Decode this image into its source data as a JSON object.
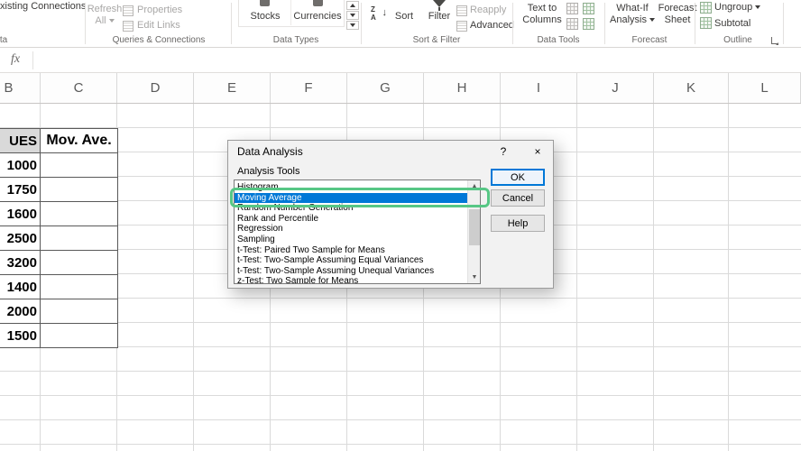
{
  "colors": {
    "selection_blue": "#0078d7",
    "annotation_green": "#57c785",
    "table_header_fill": "#d9d9d9",
    "grid_line": "#dadada"
  },
  "icons": {
    "letter_z": "Z",
    "letter_a": "A",
    "arrow_down": "↓",
    "help": "?",
    "close": "×",
    "scroll_up": "▲",
    "scroll_down": "▼"
  },
  "ribbon": {
    "clipped_button_label": "xisting Connections",
    "clipped_group_label": "ta",
    "refresh_line1": "Refresh",
    "refresh_line2": "All",
    "properties_label": "Properties",
    "edit_links_label": "Edit Links",
    "queries_group_label": "Queries & Connections",
    "stocks_label": "Stocks",
    "currencies_label": "Currencies",
    "data_types_group_label": "Data Types",
    "sort_label": "Sort",
    "filter_label": "Filter",
    "reapply_label": "Reapply",
    "advanced_label": "Advanced",
    "sort_filter_group_label": "Sort & Filter",
    "text_to_columns_line1": "Text to",
    "text_to_columns_line2": "Columns",
    "data_tools_group_label": "Data Tools",
    "what_if_line1": "What-If",
    "what_if_line2": "Analysis",
    "forecast_sheet_line1": "Forecast",
    "forecast_sheet_line2": "Sheet",
    "forecast_group_label": "Forecast",
    "ungroup_label": "Ungroup",
    "subtotal_label": "Subtotal",
    "outline_group_label": "Outline"
  },
  "formula_bar": {
    "fx_label": "fx"
  },
  "sheet": {
    "column_headers": [
      "B",
      "C",
      "D",
      "E",
      "F",
      "G",
      "H",
      "I",
      "J",
      "K",
      "L"
    ],
    "table": {
      "values_header": "UES",
      "moving_average_header": "Mov. Ave.",
      "values": [
        "1000",
        "1750",
        "1600",
        "2500",
        "3200",
        "1400",
        "2000",
        "1500"
      ]
    }
  },
  "dialog": {
    "title": "Data Analysis",
    "analysis_tools_label": "Analysis Tools",
    "tools": [
      "Histogram",
      "Moving Average",
      "Random Number Generation",
      "Rank and Percentile",
      "Regression",
      "Sampling",
      "t-Test: Paired Two Sample for Means",
      "t-Test: Two-Sample Assuming Equal Variances",
      "t-Test: Two-Sample Assuming Unequal Variances",
      "z-Test: Two Sample for Means"
    ],
    "selected_tool": "Moving Average",
    "ok_button": "OK",
    "cancel_button": "Cancel",
    "help_button": "Help"
  }
}
